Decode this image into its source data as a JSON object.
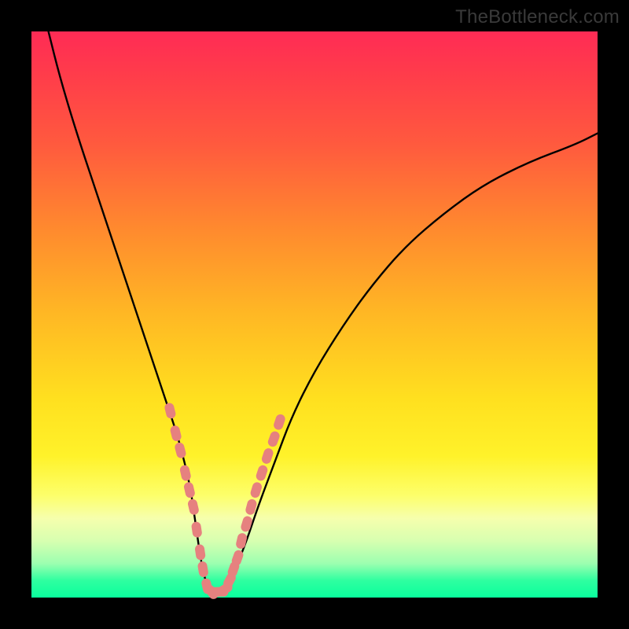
{
  "watermark": "TheBottleneck.com",
  "chart_data": {
    "type": "line",
    "title": "",
    "xlabel": "",
    "ylabel": "",
    "ylim": [
      0,
      100
    ],
    "xlim": [
      0,
      100
    ],
    "series": [
      {
        "name": "bottleneck-curve",
        "x": [
          3,
          5,
          8,
          12,
          16,
          20,
          24,
          26,
          28,
          29,
          30,
          31,
          32,
          33,
          34,
          36,
          38,
          40,
          43,
          46,
          50,
          55,
          60,
          66,
          73,
          80,
          88,
          96,
          100
        ],
        "y": [
          100,
          92,
          82,
          70,
          58,
          46,
          34,
          28,
          20,
          13,
          6,
          2,
          1,
          1,
          2,
          5,
          10,
          16,
          24,
          32,
          40,
          48,
          55,
          62,
          68,
          73,
          77,
          80,
          82
        ]
      }
    ],
    "highlight_points": {
      "name": "pink-markers",
      "color": "#e6817f",
      "x": [
        24.5,
        25.5,
        26.3,
        27.2,
        27.9,
        28.6,
        29.2,
        29.8,
        30.3,
        31.0,
        31.8,
        32.6,
        33.4,
        34.2,
        35.0,
        35.7,
        36.4,
        37.1,
        38.0,
        38.8,
        39.7,
        40.7,
        41.7,
        42.8,
        43.8
      ],
      "y": [
        33,
        29,
        26,
        22,
        19,
        16,
        12,
        8,
        5,
        2,
        1,
        1,
        1,
        1.5,
        3,
        5,
        7,
        10,
        13,
        16,
        19,
        22,
        25,
        28,
        31
      ]
    }
  }
}
